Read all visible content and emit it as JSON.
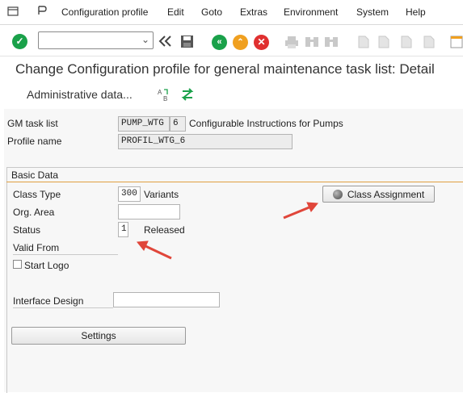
{
  "menubar": {
    "items": [
      "Configuration profile",
      "Edit",
      "Goto",
      "Extras",
      "Environment",
      "System",
      "Help"
    ]
  },
  "toolbar": {
    "command_field_value": ""
  },
  "page": {
    "title": "Change Configuration profile for general maintenance task list: Detail"
  },
  "app_toolbar": {
    "admin_label": "Administrative data..."
  },
  "header_fields": {
    "gm_task_list_label": "GM task list",
    "gm_task_list_value": "PUMP_WTG",
    "gm_task_list_counter": "6",
    "gm_task_list_desc": "Configurable Instructions for Pumps",
    "profile_name_label": "Profile name",
    "profile_name_value": "PROFIL_WTG_6"
  },
  "basic_data": {
    "title": "Basic Data",
    "class_type_label": "Class Type",
    "class_type_value": "300",
    "class_type_desc": "Variants",
    "org_area_label": "Org. Area",
    "org_area_value": "",
    "status_label": "Status",
    "status_value": "1",
    "status_desc": "Released",
    "valid_from_label": "Valid From",
    "start_logo_label": "Start Logo",
    "interface_design_label": "Interface Design",
    "interface_design_value": "",
    "settings_button": "Settings",
    "class_assignment_button": "Class Assignment"
  },
  "colors": {
    "arrow": "#e0463a",
    "green": "#1aa14a",
    "orange": "#f0a020",
    "red": "#e03030"
  }
}
